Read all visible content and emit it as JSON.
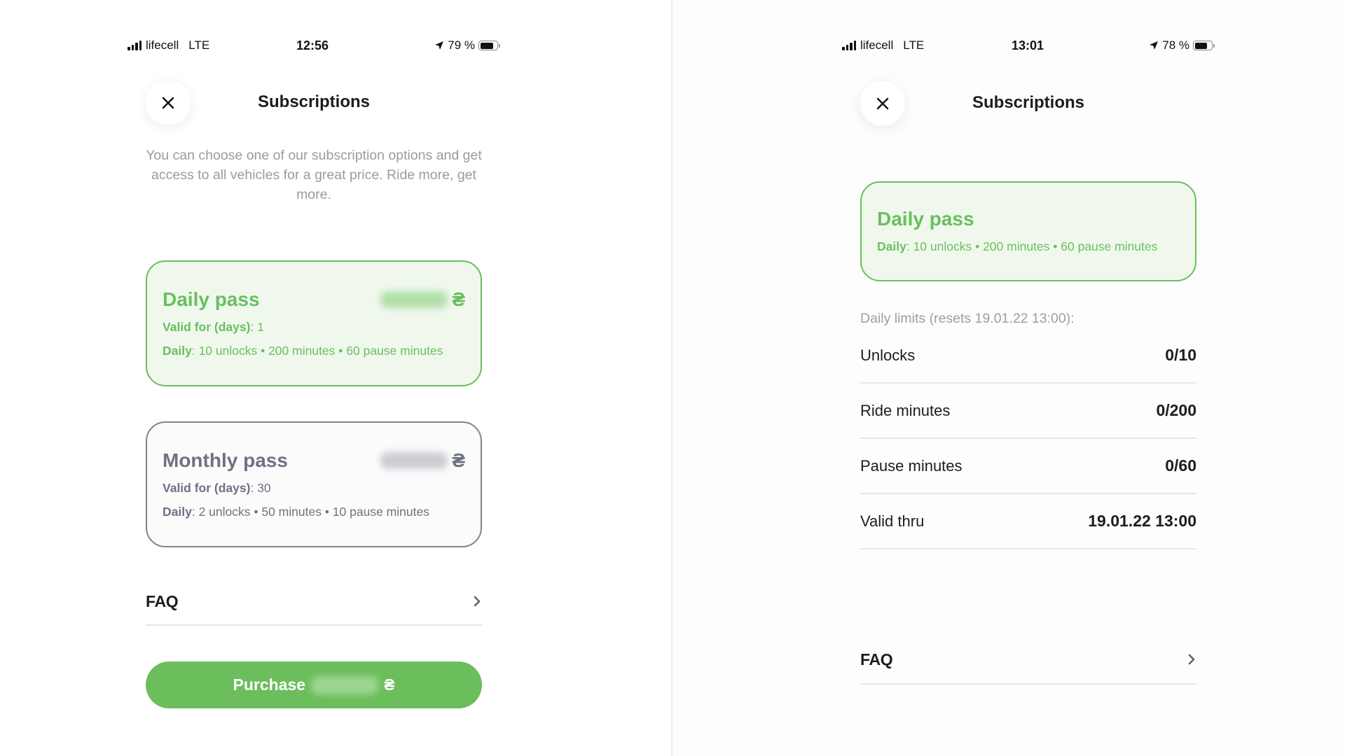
{
  "left_screen": {
    "status_bar": {
      "carrier": "lifecell",
      "network": "LTE",
      "time": "12:56",
      "battery_percent": "79 %",
      "battery_level": 0.79
    },
    "header": {
      "title": "Subscriptions",
      "close_icon": "close-icon"
    },
    "description": "You can choose one of our subscription options and get access to all vehicles for a great price. Ride more, get more.",
    "plans": [
      {
        "name": "Daily pass",
        "price_hidden": true,
        "currency": "₴",
        "selected": true,
        "valid_label": "Valid for (days)",
        "valid_value": "1",
        "daily_label": "Daily",
        "daily_value": "10 unlocks • 200 minutes • 60 pause minutes"
      },
      {
        "name": "Monthly pass",
        "price_hidden": true,
        "currency": "₴",
        "selected": false,
        "valid_label": "Valid for (days)",
        "valid_value": "30",
        "daily_label": "Daily",
        "daily_value": "2 unlocks • 50 minutes • 10 pause minutes"
      }
    ],
    "faq_label": "FAQ",
    "purchase": {
      "label": "Purchase",
      "currency": "₴",
      "price_hidden": true
    }
  },
  "right_screen": {
    "status_bar": {
      "carrier": "lifecell",
      "network": "LTE",
      "time": "13:01",
      "battery_percent": "78 %",
      "battery_level": 0.78
    },
    "header": {
      "title": "Subscriptions",
      "close_icon": "close-icon"
    },
    "active_plan": {
      "name": "Daily pass",
      "daily_label": "Daily",
      "daily_value": "10 unlocks • 200 minutes • 60 pause minutes"
    },
    "limits_caption": "Daily limits (resets 19.01.22 13:00):",
    "limits": [
      {
        "label": "Unlocks",
        "value": "0/10"
      },
      {
        "label": "Ride minutes",
        "value": "0/200"
      },
      {
        "label": "Pause minutes",
        "value": "0/60"
      },
      {
        "label": "Valid thru",
        "value": "19.01.22 13:00"
      }
    ],
    "faq_label": "FAQ"
  },
  "colors": {
    "accent_green": "#6abf5e",
    "card_selected_bg": "#f0f8ee",
    "muted_grey": "#6e7282",
    "text_dark": "#1c1c22"
  }
}
